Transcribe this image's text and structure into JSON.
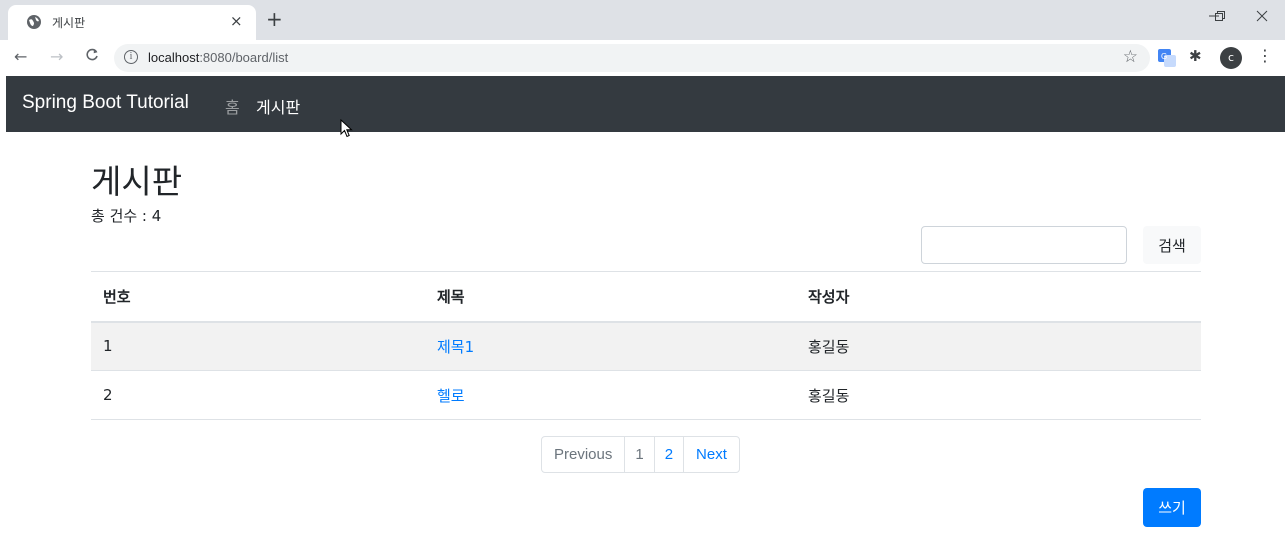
{
  "browser": {
    "tab_title": "게시판",
    "tab_close": "×",
    "new_tab": "+",
    "url_host": "localhost",
    "url_rest": ":8080/board/list",
    "info_icon_glyph": "i",
    "star_glyph": "☆",
    "avatar_letter": "c",
    "window_minimize": "—",
    "window_restore": "❐",
    "window_close": "✕",
    "back_glyph": "←",
    "forward_glyph": "→",
    "reload_glyph": "C",
    "kebab_glyph": "⋮",
    "puzzle_glyph": "✱"
  },
  "navbar": {
    "brand": "Spring Boot Tutorial",
    "links": [
      {
        "label": "홈",
        "active": false
      },
      {
        "label": "게시판",
        "active": true
      }
    ],
    "background": "#343a40"
  },
  "page": {
    "title": "게시판",
    "total_count_text": "총 건수 : 4"
  },
  "search": {
    "value": "",
    "button_label": "검색"
  },
  "table": {
    "headers": [
      "번호",
      "제목",
      "작성자"
    ],
    "rows": [
      {
        "no": "1",
        "title": "제목1",
        "author": "홍길동"
      },
      {
        "no": "2",
        "title": "헬로",
        "author": "홍길동"
      }
    ]
  },
  "pagination": {
    "previous": "Previous",
    "pages": [
      "1",
      "2"
    ],
    "current_page": "1",
    "next": "Next"
  },
  "actions": {
    "write_label": "쓰기"
  },
  "colors": {
    "primary": "#007bff",
    "dark": "#343a40"
  }
}
